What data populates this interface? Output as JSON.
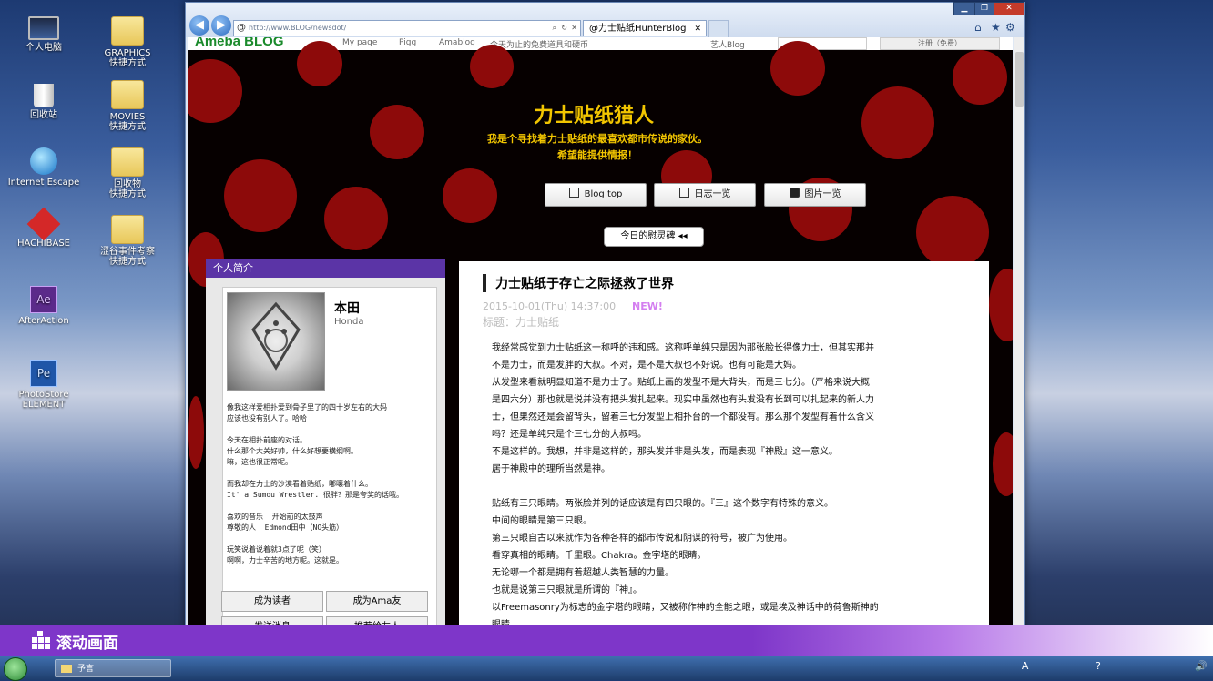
{
  "desktop": {
    "icons": [
      {
        "label": "个人电脑"
      },
      {
        "label": "回收站"
      },
      {
        "label": "Internet Escape"
      },
      {
        "label": "HACHIBASE"
      },
      {
        "label": "AfterAction"
      },
      {
        "label": "PhotoStore\nELEMENT"
      },
      {
        "label": "GRAPHICS\n快捷方式"
      },
      {
        "label": "MOVIES\n快捷方式"
      },
      {
        "label": "回收物\n快捷方式"
      },
      {
        "label": "涩谷事件考察\n快捷方式"
      }
    ]
  },
  "browser": {
    "address": "http://www.BLOG/newsdot/",
    "tab_title": "@力士贴纸HunterBlog",
    "ameba_bar": {
      "logo": "Ameba BLOG",
      "links": [
        "My page",
        "Pigg",
        "Amablog",
        "今天为止的免费道具和硬币",
        "艺人Blog"
      ],
      "register": "注册（免费）"
    }
  },
  "blog": {
    "title": "力士贴纸猎人",
    "subtitle_line1": "我是个寻找着力士贴纸的最喜欢都市传说的家伙。",
    "subtitle_line2": "希望能提供情报！",
    "nav": [
      "Blog top",
      "日志一览",
      "图片一览"
    ],
    "irei_button": "今日的慰灵碑 ◂◂",
    "profile": {
      "header": "个人简介",
      "name": "本田",
      "name_romaji": "Honda",
      "bio": "像我这样爱相扑爱到骨子里了的四十岁左右的大妈\n应该也没有别人了。哈哈\n\n今天在相扑前座的对话。\n什么那个大关好帅，什么好想要横纲啊。\n嘛，这也很正常呢。\n\n而我却在力士的沙漠看着贴纸，嘟嚷着什么。\nIt' a Sumou Wrestler. 很胖？那是夸奖的话哦。\n\n喜欢的音乐  开始前的太鼓声\n尊敬的人  Edmond田中（NO头筋）\n\n玩笑说着说着就3点了呢（笑）\n啊啊，力士辛苦的地方呢。这就是。",
      "buttons": [
        "成为读者",
        "成为Ama友",
        "发送消息",
        "推荐给友人"
      ]
    },
    "post": {
      "title": "力士贴纸于存亡之际拯救了世界",
      "date": "2015-10-01(Thu) 14:37:00",
      "new_badge": "NEW!",
      "theme": "标题：力士贴纸",
      "body": [
        "我经常感觉到力士贴纸这一称呼的违和感。这称呼单纯只是因为那张脸长得像力士，但其实那并",
        "不是力士，而是发胖的大叔。不对，是不是大叔也不好说。也有可能是大妈。",
        "从发型来看就明显知道不是力士了。贴纸上画的发型不是大背头，而是三七分。（严格来说大概",
        "是四六分）那也就是说并没有把头发扎起来。现实中虽然也有头发没有长到可以扎起来的新人力",
        "士，但果然还是会留背头，留着三七分发型上相扑台的一个都没有。那么那个发型有着什么含义",
        "吗？还是单纯只是个三七分的大叔吗。",
        "不是这样的。我想，并非是这样的，那头发并非是头发，而是表现『神殿』这一意义。",
        "居于神殿中的理所当然是神。",
        "",
        "贴纸有三只眼睛。两张脸并列的话应该是有四只眼的。『三』这个数字有特殊的意义。",
        "中间的眼睛是第三只眼。",
        "第三只眼自古以来就作为各种各样的都市传说和阴谋的符号，被广为使用。",
        "看穿真相的眼睛。千里眼。Chakra。金字塔的眼睛。",
        "无论哪一个都是拥有着超越人类智慧的力量。",
        "也就是说第三只眼就是所谓的『神』。",
        "以Freemasonry为标志的金字塔的眼睛，又被称作神的全能之眼，或是埃及神话中的荷鲁斯神的",
        "眼睛。"
      ]
    }
  },
  "overlay": {
    "label": "滚动画面"
  },
  "taskbar": {
    "task": "予言"
  }
}
